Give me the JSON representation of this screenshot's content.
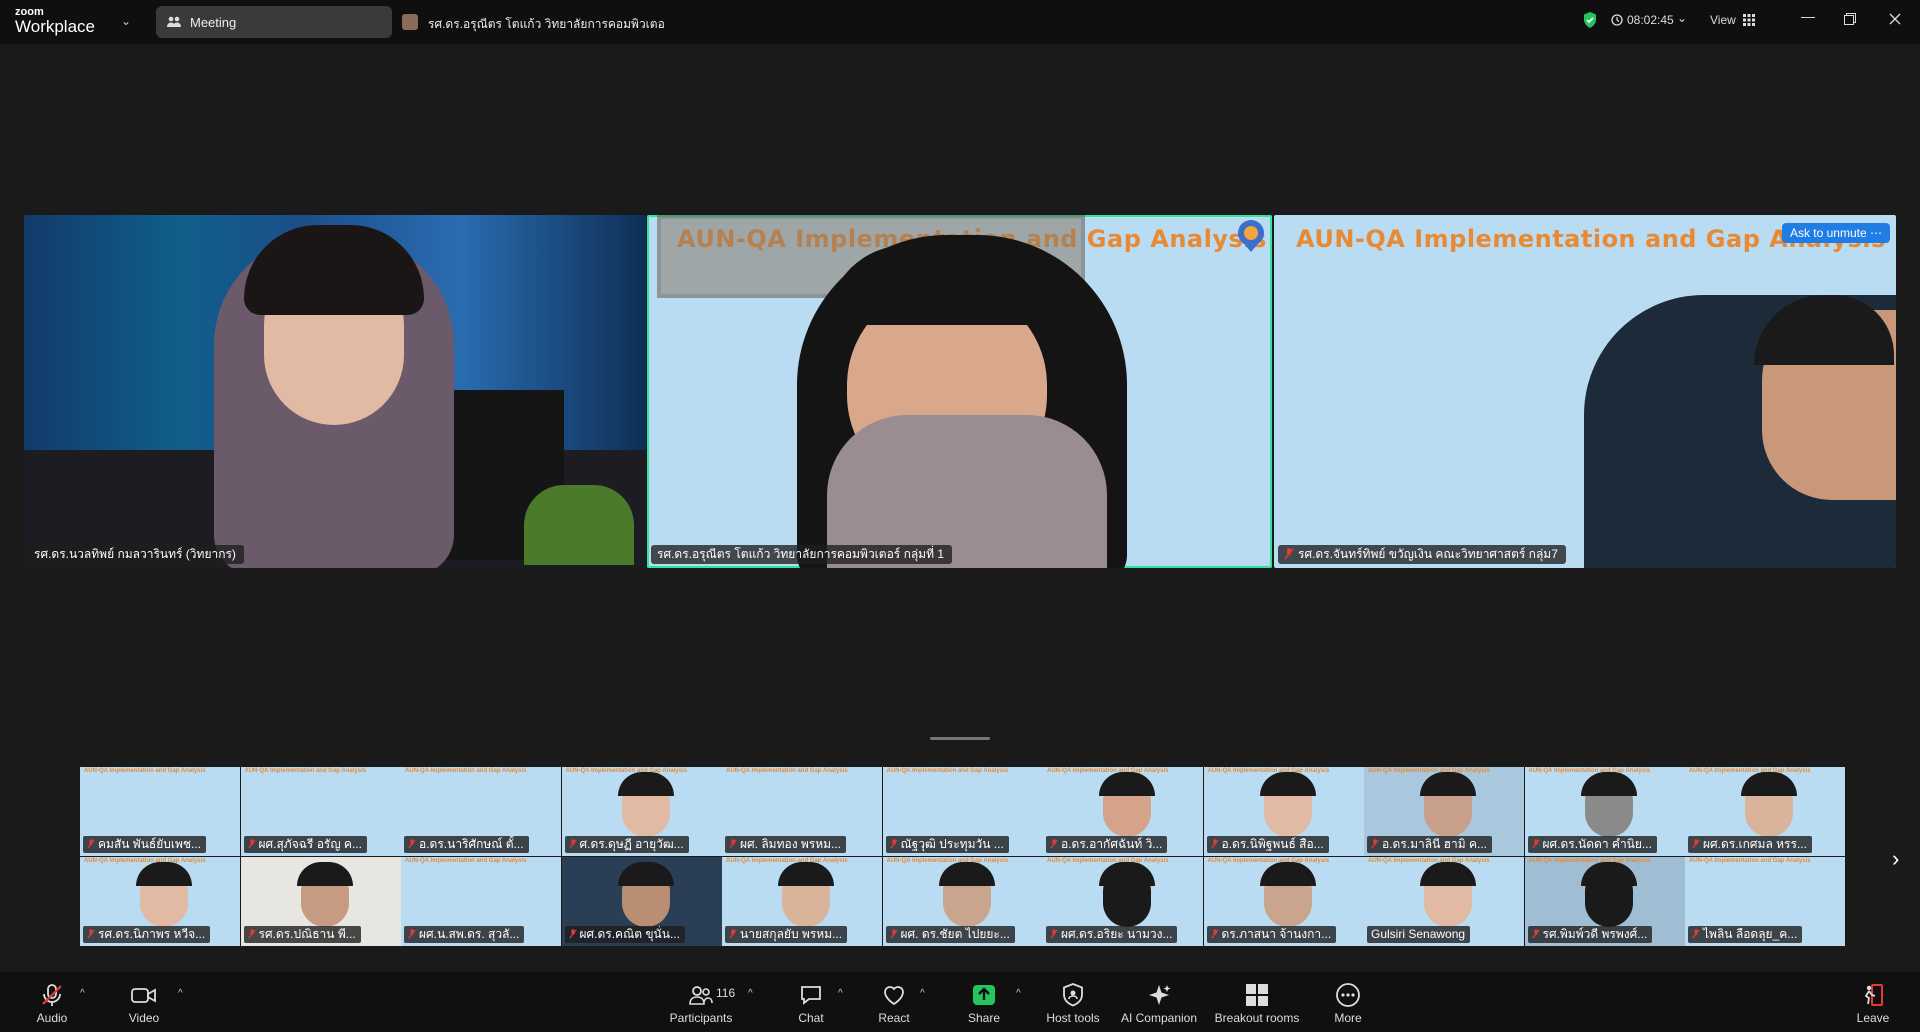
{
  "titlebar": {
    "brand_small": "zoom",
    "brand_large": "Workplace",
    "meeting_tab": "Meeting",
    "host_tab": "รศ.ดร.อรุณีตร โตแก้ว วิทยาลัยการคอมพิวเตอ",
    "timer": "08:02:45",
    "view_label": "View"
  },
  "slide_title": "AUN-QA Implementation and Gap Analysis",
  "main_tiles": [
    {
      "name": "รศ.ดร.นวลทิพย์ กมลวารินทร์ (วิทยากร)"
    },
    {
      "name": "รศ.ดร.อรุณีตร โตแก้ว วิทยาลัยการคอมพิวเตอร์ กลุ่มที่ 1"
    },
    {
      "name": "รศ.ดร.จันทร์ทิพย์ ขวัญเงิน คณะวิทยาศาสตร์ กลุ่ม7",
      "ask": "Ask to unmute"
    }
  ],
  "thumbs_row1": [
    "คมสัน พันธ์ยับเพช...",
    "ผศ.สุภัจฉรี อรัญ ค...",
    "อ.ดร.นาริศักษณ์ ตั้...",
    "ศ.ดร.ดุษฏี อายุวัฒ...",
    "ผศ. ลิมทอง พรหม...",
    "ณัฐวุฒิ ประทุมวัน ...",
    "อ.ดร.อากัศฉันท์ วิ...",
    "อ.ดร.นิพิฐพนธ์ สือ...",
    "อ.ดร.มาลินี ฮามิ ค...",
    "ผศ.ดร.นัดดา คำนิย...",
    "ผศ.ดร.เกศมล หรร..."
  ],
  "thumbs_row2": [
    "รศ.ดร.นิภาพร หวีจ...",
    "รศ.ดร.ปณิธาน พี...",
    "ผศ.น.สพ.ดร. สุวลั...",
    "ผศ.ดร.คณิต ขุนั่น...",
    "นายสกุลยับ พรหม...",
    "ผศ. ดร.ชัยต ไปยยะ...",
    "ผศ.ดร.อริยะ นามวง...",
    "ดร.ภาสนา จ้านงกา...",
    "Gulsiri Senawong",
    "รศ.พิมพ์วดี พรพงศ์...",
    "ไพลิน ลือดลุย_ค..."
  ],
  "toolbar": {
    "audio": "Audio",
    "video": "Video",
    "participants": "Participants",
    "participant_count": "116",
    "chat": "Chat",
    "react": "React",
    "share": "Share",
    "host_tools": "Host tools",
    "ai_companion": "AI Companion",
    "breakout": "Breakout rooms",
    "more": "More",
    "leave": "Leave"
  },
  "colors": {
    "share_green": "#22c55e",
    "active_border": "#2ee59d",
    "leave_red": "#e53935",
    "unmute_blue": "#1f7de4",
    "slide_orange": "#e88a33",
    "slide_bg": "#b9dcf3"
  }
}
